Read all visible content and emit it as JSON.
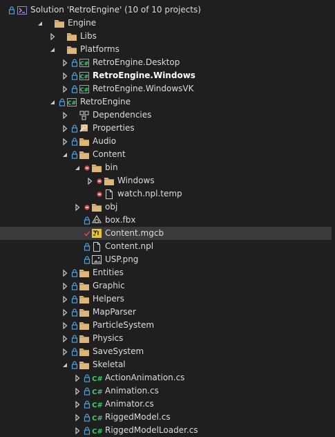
{
  "colors": {
    "folder": "#dcb67a",
    "folder_dark": "#b8944f",
    "csharp": "#3dcb6b",
    "lock": "#4fa3e0",
    "no_source": "#d64a4a",
    "check": "#d64a4a",
    "selection": "#3a3a3a"
  },
  "rows": [
    {
      "label": "Solution 'RetroEngine' (10 of 10 projects)",
      "depth": 0,
      "icon": "solution-icon",
      "state": "",
      "lock": true,
      "name": "solution-node"
    },
    {
      "label": "Engine",
      "depth": 1,
      "icon": "folder-icon",
      "state": "expanded",
      "lock": false,
      "name": "folder-engine"
    },
    {
      "label": "Libs",
      "depth": 2,
      "icon": "folder-icon",
      "state": "collapsed",
      "lock": false,
      "name": "folder-libs"
    },
    {
      "label": "Platforms",
      "depth": 2,
      "icon": "folder-icon",
      "state": "expanded",
      "lock": false,
      "name": "folder-platforms"
    },
    {
      "label": "RetroEngine.Desktop",
      "depth": 3,
      "icon": "csproj-icon",
      "state": "collapsed",
      "lock": true,
      "name": "project-retroengine-desktop"
    },
    {
      "label": "RetroEngine.Windows",
      "depth": 3,
      "icon": "csproj-icon",
      "state": "collapsed",
      "lock": true,
      "bold": true,
      "name": "project-retroengine-windows"
    },
    {
      "label": "RetroEngine.WindowsVK",
      "depth": 3,
      "icon": "csproj-icon",
      "state": "collapsed",
      "lock": true,
      "name": "project-retroengine-windowsvk"
    },
    {
      "label": "RetroEngine",
      "depth": 2,
      "icon": "csproj-icon",
      "state": "expanded",
      "lock": true,
      "name": "project-retroengine"
    },
    {
      "label": "Dependencies",
      "depth": 3,
      "icon": "dependencies-icon",
      "state": "collapsed",
      "lock": false,
      "name": "node-dependencies"
    },
    {
      "label": "Properties",
      "depth": 3,
      "icon": "properties-icon",
      "state": "collapsed",
      "lock": true,
      "name": "node-properties"
    },
    {
      "label": "Audio",
      "depth": 3,
      "icon": "folder-icon",
      "state": "collapsed",
      "lock": true,
      "name": "folder-audio"
    },
    {
      "label": "Content",
      "depth": 3,
      "icon": "folder-icon",
      "state": "expanded",
      "lock": true,
      "name": "folder-content"
    },
    {
      "label": "bin",
      "depth": 4,
      "icon": "folder-icon",
      "state": "expanded",
      "lock": false,
      "nosource": true,
      "name": "folder-bin"
    },
    {
      "label": "Windows",
      "depth": 5,
      "icon": "folder-icon",
      "state": "collapsed",
      "lock": false,
      "nosource": true,
      "name": "folder-windows"
    },
    {
      "label": "watch.npl.temp",
      "depth": 5,
      "icon": "file-icon",
      "state": "",
      "lock": false,
      "nosource": true,
      "name": "file-watch-npl-temp"
    },
    {
      "label": "obj",
      "depth": 4,
      "icon": "folder-icon",
      "state": "collapsed",
      "lock": false,
      "nosource": true,
      "name": "folder-obj"
    },
    {
      "label": "box.fbx",
      "depth": 4,
      "icon": "fbx-icon",
      "state": "",
      "lock": true,
      "name": "file-box-fbx"
    },
    {
      "label": "Content.mgcb",
      "depth": 4,
      "icon": "mgcb-icon",
      "state": "",
      "lock": false,
      "checked": true,
      "selected": true,
      "name": "file-content-mgcb"
    },
    {
      "label": "Content.npl",
      "depth": 4,
      "icon": "file-icon",
      "state": "",
      "lock": true,
      "name": "file-content-npl"
    },
    {
      "label": "USP.png",
      "depth": 4,
      "icon": "image-icon",
      "state": "",
      "lock": true,
      "name": "file-usp-png"
    },
    {
      "label": "Entities",
      "depth": 3,
      "icon": "folder-icon",
      "state": "collapsed",
      "lock": true,
      "name": "folder-entities"
    },
    {
      "label": "Graphic",
      "depth": 3,
      "icon": "folder-icon",
      "state": "collapsed",
      "lock": true,
      "name": "folder-graphic"
    },
    {
      "label": "Helpers",
      "depth": 3,
      "icon": "folder-icon",
      "state": "collapsed",
      "lock": true,
      "name": "folder-helpers"
    },
    {
      "label": "MapParser",
      "depth": 3,
      "icon": "folder-icon",
      "state": "collapsed",
      "lock": true,
      "name": "folder-mapparser"
    },
    {
      "label": "ParticleSystem",
      "depth": 3,
      "icon": "folder-icon",
      "state": "collapsed",
      "lock": true,
      "name": "folder-particlesystem"
    },
    {
      "label": "Physics",
      "depth": 3,
      "icon": "folder-icon",
      "state": "collapsed",
      "lock": true,
      "name": "folder-physics"
    },
    {
      "label": "SaveSystem",
      "depth": 3,
      "icon": "folder-icon",
      "state": "collapsed",
      "lock": true,
      "name": "folder-savesystem"
    },
    {
      "label": "Skeletal",
      "depth": 3,
      "icon": "folder-icon",
      "state": "expanded",
      "lock": true,
      "name": "folder-skeletal"
    },
    {
      "label": "ActionAnimation.cs",
      "depth": 4,
      "icon": "cs-file-icon",
      "state": "collapsed",
      "lock": true,
      "name": "file-actionanimation-cs"
    },
    {
      "label": "Animation.cs",
      "depth": 4,
      "icon": "cs-file-icon",
      "state": "collapsed",
      "lock": true,
      "name": "file-animation-cs"
    },
    {
      "label": "Animator.cs",
      "depth": 4,
      "icon": "cs-file-icon",
      "state": "collapsed",
      "lock": true,
      "name": "file-animator-cs"
    },
    {
      "label": "RiggedModel.cs",
      "depth": 4,
      "icon": "cs-file-icon",
      "state": "collapsed",
      "lock": true,
      "name": "file-riggedmodel-cs"
    },
    {
      "label": "RiggedModelLoader.cs",
      "depth": 4,
      "icon": "cs-file-icon",
      "state": "collapsed",
      "lock": true,
      "name": "file-riggedmodelloader-cs"
    }
  ]
}
